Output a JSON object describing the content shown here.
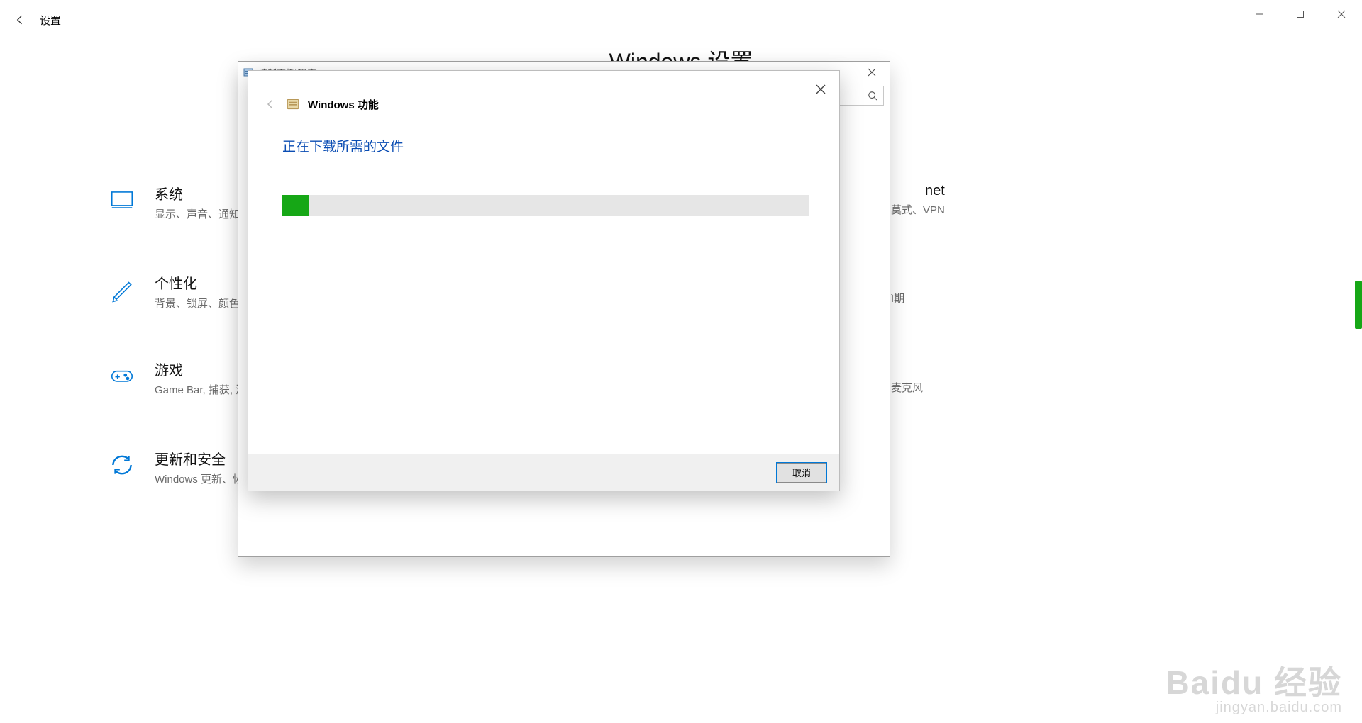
{
  "settings": {
    "title": "设置",
    "heading": "Windows 设置",
    "categories": [
      {
        "title": "系统",
        "subtitle": "显示、声音、通知、"
      },
      {
        "title": "个性化",
        "subtitle": "背景、锁屏、颜色"
      },
      {
        "title": "游戏",
        "subtitle": "Game Bar, 捕获, 游"
      },
      {
        "title": "更新和安全",
        "subtitle": "Windows 更新、恢"
      }
    ],
    "right_fragments": [
      {
        "title": "net",
        "subtitle": "莫式、VPN"
      },
      {
        "title": "",
        "subtitle": "ì期"
      },
      {
        "title": "",
        "subtitle": "麦克风"
      }
    ]
  },
  "control_panel_window": {
    "title": "控制面板\\程序"
  },
  "modal": {
    "title": "Windows 功能",
    "message": "正在下载所需的文件",
    "progress_percent": 5,
    "cancel_label": "取消"
  },
  "watermark": {
    "line1": "Baidu 经验",
    "line2": "jingyan.baidu.com"
  }
}
